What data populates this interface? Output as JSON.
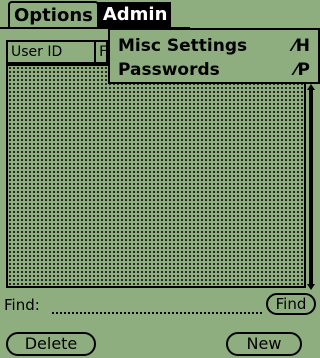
{
  "menubar": {
    "options_label": "Options",
    "admin_label": "Admin"
  },
  "dropdown": {
    "items": [
      {
        "label": "Misc Settings",
        "shortcut": "⁄H"
      },
      {
        "label": "Passwords",
        "shortcut": "⁄P"
      }
    ]
  },
  "table": {
    "columns": [
      "User ID",
      "F"
    ]
  },
  "find": {
    "label": "Find:",
    "value": "",
    "button_label": "Find"
  },
  "buttons": {
    "delete_label": "Delete",
    "new_label": "New"
  },
  "colors": {
    "background": "#8fae7f",
    "foreground": "#000000"
  }
}
